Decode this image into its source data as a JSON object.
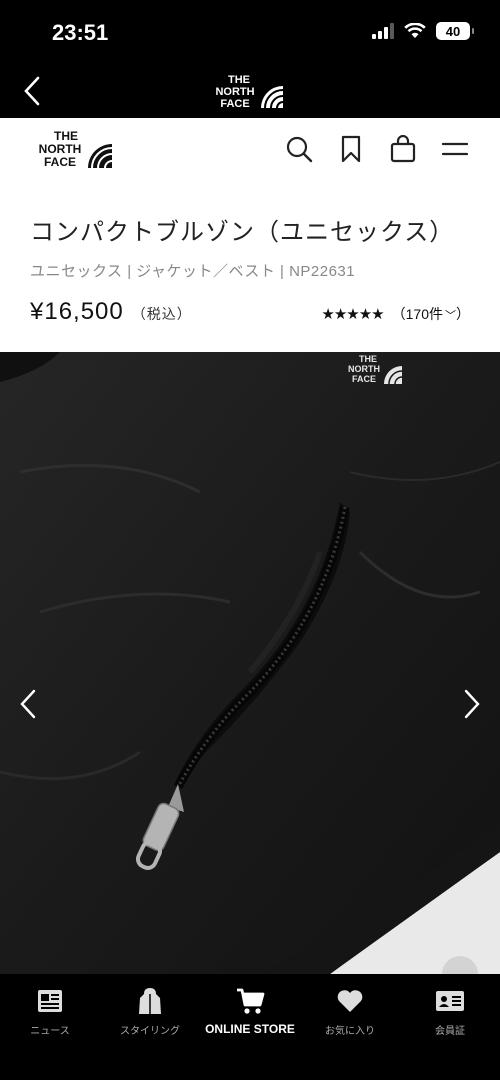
{
  "status_bar": {
    "time": "23:51",
    "battery": "40",
    "icons": [
      "signal-icon",
      "wifi-icon",
      "battery-icon"
    ]
  },
  "app_nav": {
    "logo_lines": [
      "THE",
      "NORTH",
      "FACE"
    ],
    "back_icon": "chevron-left-icon"
  },
  "header": {
    "logo_lines": [
      "THE",
      "NORTH",
      "FACE"
    ],
    "icons": [
      "search-icon",
      "bookmark-icon",
      "cart-icon",
      "menu-icon"
    ]
  },
  "product": {
    "title": "コンパクトブルゾン（ユニセックス）",
    "meta": "ユニセックス | ジャケット／ベスト | NP22631",
    "price": "¥16,500",
    "tax_label": "（税込）",
    "stars": "★★★★★",
    "review_count": "（170件",
    "review_chevron": "﹀",
    "image_alt": "black jacket zipper pocket",
    "image_logo_lines": [
      "THE",
      "NORTH",
      "FACE"
    ]
  },
  "tabs": [
    {
      "label": "ニュース",
      "icon": "news-icon",
      "active": false
    },
    {
      "label": "スタイリング",
      "icon": "styling-icon",
      "active": false
    },
    {
      "label": "ONLINE STORE",
      "icon": "cart-icon",
      "active": true
    },
    {
      "label": "お気に入り",
      "icon": "heart-icon",
      "active": false
    },
    {
      "label": "会員証",
      "icon": "member-card-icon",
      "active": false
    }
  ],
  "colors": {
    "background_dark": "#000000",
    "header_bg": "#ffffff",
    "text_primary": "#222222",
    "text_muted": "#888888",
    "jacket": "#1b1b1b"
  }
}
